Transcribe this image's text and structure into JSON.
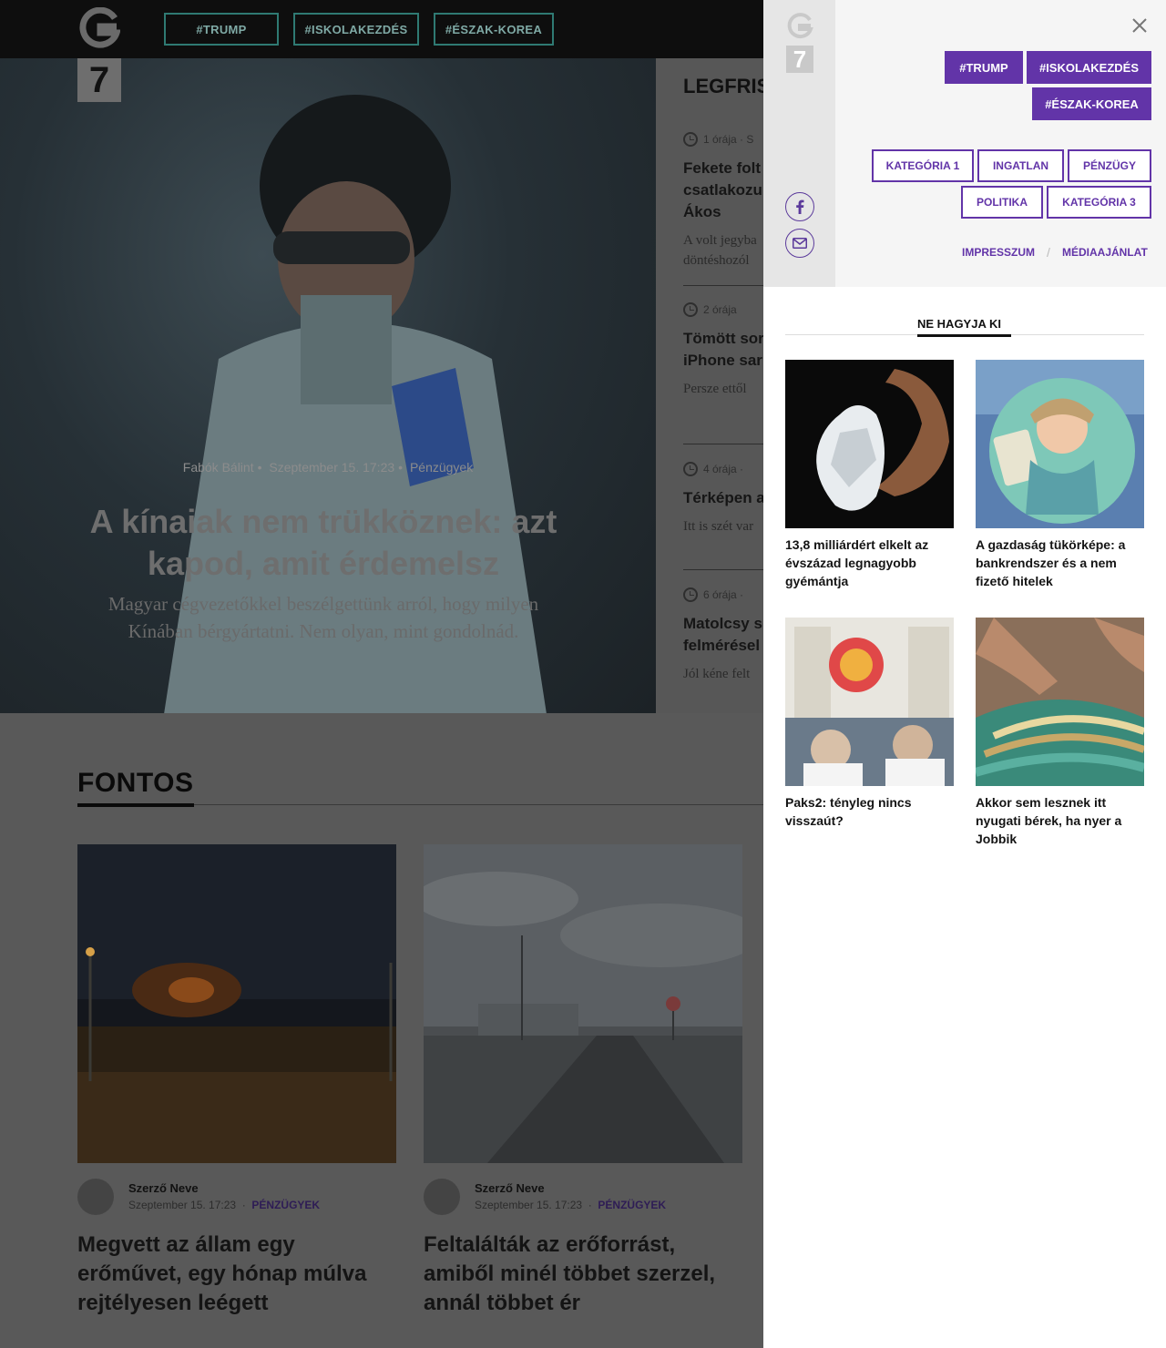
{
  "header": {
    "logo_letter": "G",
    "logo_number": "7",
    "tags": [
      "#TRUMP",
      "#ISKOLAKEZDÉS",
      "#ÉSZAK-KOREA"
    ]
  },
  "hero": {
    "author": "Fabók Bálint",
    "date": "Szeptember 15. 17:23",
    "category": "Pénzügyek",
    "title": "A kínaiak nem trükköznek: azt kapod, amit érdemelsz",
    "lead": "Magyar cégvezetőkkel beszélgettünk arról, hogy milyen Kínában bérgyártatni. Nem olyan, mint gondolnád."
  },
  "latest": {
    "heading": "LEGFRIS",
    "items": [
      {
        "time": "1 órája  ·  S",
        "title": "Fekete folt\ncsatlakozu\nÁkos",
        "desc": "A volt jegyba\ndöntéshozól"
      },
      {
        "time": "2 órája",
        "title": "Tömött sor\niPhone sar",
        "desc": "Persze ettől"
      },
      {
        "time": "4 órája  ·",
        "title": "Térképen a",
        "desc": "Itt is szét var"
      },
      {
        "time": "6 órája  ·",
        "title": "Matolcsy s\nfelmérésel",
        "desc": "Jól kéne felt"
      }
    ]
  },
  "fontos": {
    "heading": "FONTOS",
    "cards": [
      {
        "author": "Szerző Neve",
        "date": "Szeptember 15. 17:23",
        "category": "PÉNZÜGYEK",
        "title": "Megvett az állam egy erőművet, egy hónap múlva rejtélyesen leégett"
      },
      {
        "author": "Szerző Neve",
        "date": "Szeptember 15. 17:23",
        "category": "PÉNZÜGYEK",
        "title": " Feltalálták az erőforrást, amiből minél többet szerzel, annál többet ér"
      }
    ]
  },
  "panel": {
    "logo_letter": "G",
    "logo_number": "7",
    "close_icon": "close-icon",
    "tags": [
      "#TRUMP",
      "#ISKOLAKEZDÉS",
      "#ÉSZAK-KOREA"
    ],
    "categories": [
      "KATEGÓRIA 1",
      "INGATLAN",
      "PÉNZÜGY",
      "POLITIKA",
      "KATEGÓRIA 3"
    ],
    "links": [
      "IMPRESSZUM",
      "MÉDIAAJÁNLAT"
    ],
    "link_separator": "/",
    "social": [
      "facebook-icon",
      "mail-icon"
    ],
    "section_title": "NE HAGYJA KI",
    "articles": [
      {
        "title": "13,8 milliárdért elkelt az évszázad legnagyobb gyémántja"
      },
      {
        "title": "A gazdaság tükörképe: a bankrendszer és a nem fizető hitelek"
      },
      {
        "title": "Paks2: tényleg nincs visszaút?"
      },
      {
        "title": "Akkor sem lesznek itt nyugati bérek, ha nyer a Jobbik"
      }
    ]
  },
  "colors": {
    "accent": "#6234a8",
    "overlay_dim": "#595959",
    "topbar": "#0e0e0e"
  }
}
